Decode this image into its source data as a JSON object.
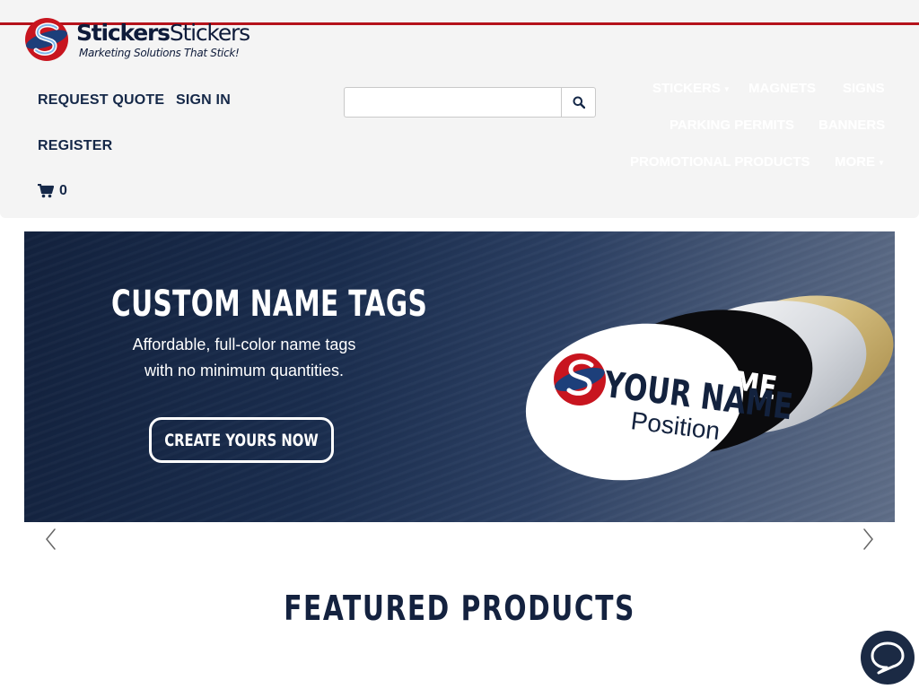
{
  "brand": {
    "name_first": "Stickers",
    "name_second": "Stickers",
    "tagline": "Marketing Solutions That Stick!",
    "color_primary": "#1b2a44",
    "color_accent": "#b5121b"
  },
  "account": {
    "request_quote": "REQUEST QUOTE",
    "sign_in": "SIGN IN",
    "register": "REGISTER",
    "cart_count": "0",
    "cart_icon": "shopping-cart-icon"
  },
  "search": {
    "value": "",
    "placeholder": "",
    "icon": "search-icon"
  },
  "nav": {
    "stickers": "STICKERS",
    "magnets": "MAGNETS",
    "signs": "SIGNS",
    "parking_permits": "PARKING PERMITS",
    "banners": "BANNERS",
    "promotional_products": "PROMOTIONAL PRODUCTS",
    "more": "MORE",
    "dropdown_icon": "caret-down-icon"
  },
  "hero": {
    "title": "CUSTOM NAME TAGS",
    "subtitle_line1": "Affordable, full-color name tags",
    "subtitle_line2": "with no minimum quantities.",
    "cta": "CREATE YOURS NOW",
    "tag_name": "YOUR NAME",
    "tag_position": "Position",
    "tag_back_text_1": "ME",
    "tag_back_text_2": "ME",
    "prev_icon": "chevron-left-icon",
    "next_icon": "chevron-right-icon"
  },
  "featured": {
    "heading": "FEATURED PRODUCTS"
  },
  "chat": {
    "icon": "chat-bubble-icon"
  }
}
